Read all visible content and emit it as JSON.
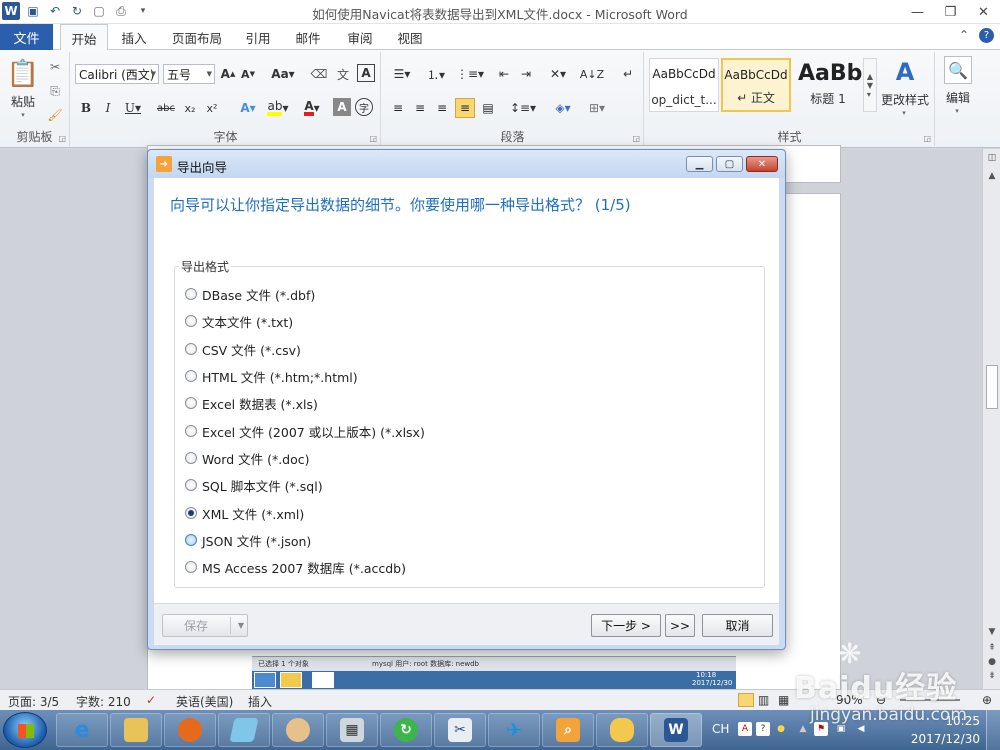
{
  "window": {
    "title": "如何使用Navicat将表数据导出到XML文件.docx - Microsoft Word"
  },
  "ribbon": {
    "file_tab": "文件",
    "tabs": [
      "开始",
      "插入",
      "页面布局",
      "引用",
      "邮件",
      "审阅",
      "视图"
    ],
    "clipboard": {
      "paste_label": "粘贴",
      "group_label": "剪贴板"
    },
    "font": {
      "family": "Calibri (西文)",
      "size": "五号",
      "group_label": "字体"
    },
    "paragraph": {
      "group_label": "段落"
    },
    "styles": {
      "group_label": "样式",
      "items": [
        {
          "sample": "AaBbCcDd",
          "name": "op_dict_t..."
        },
        {
          "sample": "AaBbCcDd",
          "name": "↵ 正文"
        },
        {
          "sample": "AaBb",
          "name": "标题 1"
        }
      ],
      "change_styles_label": "更改样式"
    },
    "editing": {
      "label": "编辑"
    }
  },
  "dialog": {
    "title": "导出向导",
    "heading": "向导可以让你指定导出数据的细节。你要使用哪一种导出格式？ (1/5)",
    "group_legend": "导出格式",
    "formats": [
      {
        "label": "DBase 文件 (*.dbf)",
        "checked": false
      },
      {
        "label": "文本文件 (*.txt)",
        "checked": false
      },
      {
        "label": "CSV 文件 (*.csv)",
        "checked": false
      },
      {
        "label": "HTML 文件 (*.htm;*.html)",
        "checked": false
      },
      {
        "label": "Excel 数据表 (*.xls)",
        "checked": false
      },
      {
        "label": "Excel 文件 (2007 或以上版本) (*.xlsx)",
        "checked": false
      },
      {
        "label": "Word 文件 (*.doc)",
        "checked": false
      },
      {
        "label": "SQL 脚本文件 (*.sql)",
        "checked": false
      },
      {
        "label": "XML 文件 (*.xml)",
        "checked": true
      },
      {
        "label": "JSON 文件 (*.json)",
        "checked": false
      },
      {
        "label": "MS Access 2007 数据库 (*.accdb)",
        "checked": false
      }
    ],
    "buttons": {
      "save": "保存",
      "next": "下一步 >",
      "last": ">>",
      "cancel": "取消"
    }
  },
  "embedded": {
    "status_left": "已选择 1 个对象",
    "status_db": "mysql  用户: root  数据库: newdb",
    "time": "10:18",
    "date": "2017/12/30"
  },
  "statusbar": {
    "page": "页面: 3/5",
    "words": "字数: 210",
    "language": "英语(美国)",
    "insert_mode": "插入",
    "zoom": "90%"
  },
  "taskbar": {
    "ime": "CH",
    "time": "10:25",
    "date": "2017/12/30"
  },
  "watermark": {
    "brand": "Baidu经验",
    "url": "jingyan.baidu.com"
  }
}
